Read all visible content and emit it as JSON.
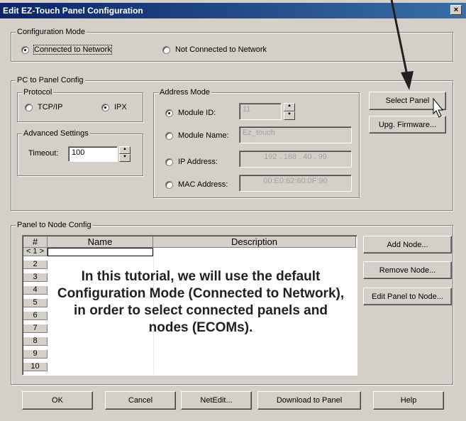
{
  "window": {
    "title": "Edit EZ-Touch Panel Configuration",
    "close_label": "×"
  },
  "config_mode": {
    "group_label": "Configuration Mode",
    "connected_label": "Connected to Network",
    "not_connected_label": "Not Connected to Network",
    "selected": "connected"
  },
  "pc_to_panel": {
    "group_label": "PC to Panel Config",
    "protocol": {
      "group_label": "Protocol",
      "tcpip_label": "TCP/IP",
      "ipx_label": "IPX",
      "selected": "IPX"
    },
    "advanced": {
      "group_label": "Advanced Settings",
      "timeout_label": "Timeout:",
      "timeout_value": "100"
    },
    "address_mode": {
      "group_label": "Address Mode",
      "module_id_label": "Module ID:",
      "module_id_value": "11",
      "module_name_label": "Module Name:",
      "module_name_value": "Ez_touch",
      "ip_label": "IP Address:",
      "ip_value": "192 . 168 . 40 . 99",
      "mac_label": "MAC Address:",
      "mac_value": "00:E0:62:60:0F:90",
      "selected": "Module ID"
    },
    "select_panel_label": "Select Panel",
    "upg_firmware_label": "Upg. Firmware..."
  },
  "panel_to_node": {
    "group_label": "Panel to Node Config",
    "columns": [
      "#",
      "Name",
      "Description"
    ],
    "rows": [
      "< 1 >",
      "2",
      "3",
      "4",
      "5",
      "6",
      "7",
      "8",
      "9",
      "10"
    ],
    "add_node_label": "Add Node...",
    "remove_node_label": "Remove Node...",
    "edit_panel_label": "Edit Panel to Node..."
  },
  "footer": {
    "ok": "OK",
    "cancel": "Cancel",
    "netedit": "NetEdit...",
    "download": "Download to Panel",
    "help": "Help"
  },
  "overlay_text": {
    "line1": "In this tutorial, we will use the default",
    "line2": "Configuration Mode (Connected to Network),",
    "line3": "in order to select connected panels and",
    "line4": "nodes (ECOMs)."
  }
}
